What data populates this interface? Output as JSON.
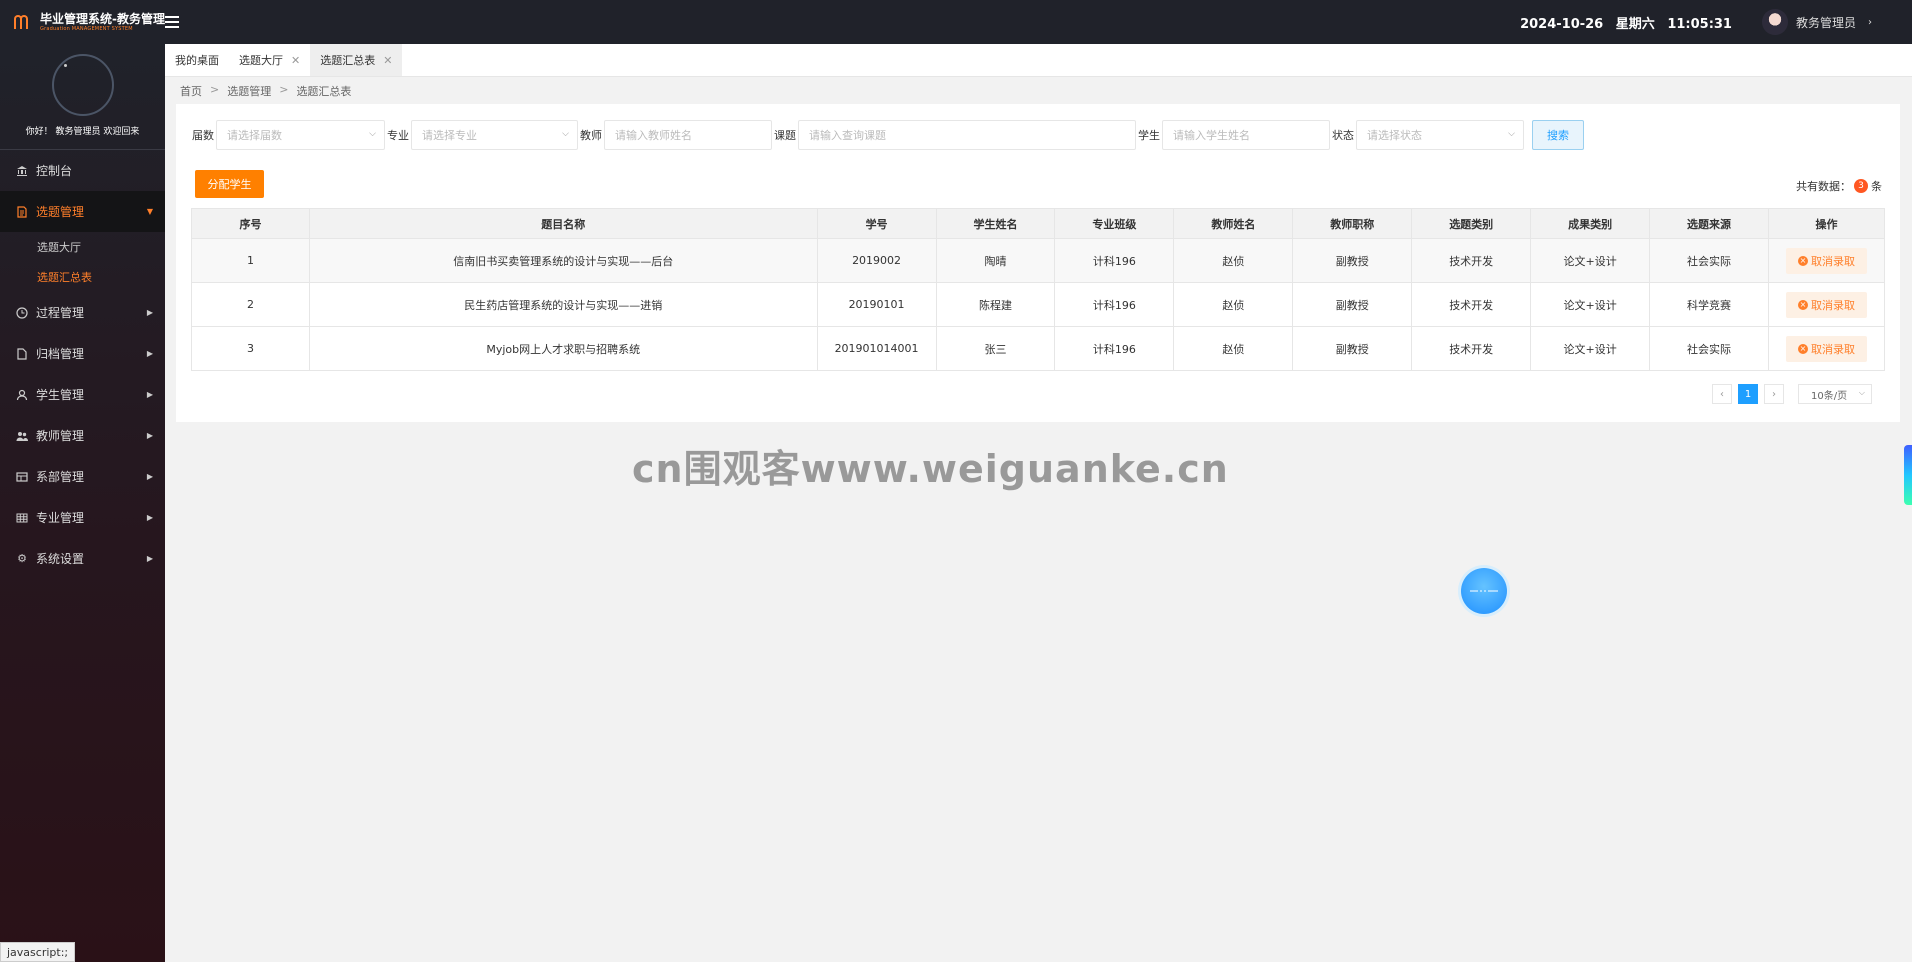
{
  "app": {
    "title": "毕业管理系统-教务管理",
    "subtitle": "Graduation MANAGEMENT SYSTEM",
    "datetime": "2024-10-26",
    "weekday": "星期六",
    "time": "11:05:31",
    "user": "教务管理员"
  },
  "sidebar": {
    "greeting": "你好！ 教务管理员 欢迎回来",
    "items": [
      {
        "label": "控制台",
        "icon": "bank-icon"
      },
      {
        "label": "选题管理",
        "icon": "document-icon",
        "active": true,
        "children": [
          {
            "label": "选题大厅"
          },
          {
            "label": "选题汇总表",
            "active": true
          }
        ]
      },
      {
        "label": "过程管理",
        "icon": "clock-icon"
      },
      {
        "label": "归档管理",
        "icon": "file-icon"
      },
      {
        "label": "学生管理",
        "icon": "user-icon"
      },
      {
        "label": "教师管理",
        "icon": "users-icon"
      },
      {
        "label": "系部管理",
        "icon": "layout-icon"
      },
      {
        "label": "专业管理",
        "icon": "grid-icon"
      },
      {
        "label": "系统设置",
        "icon": "gear-icon"
      }
    ]
  },
  "tabs": [
    {
      "label": "我的桌面"
    },
    {
      "label": "选题大厅",
      "close": "✕"
    },
    {
      "label": "选题汇总表",
      "close": "✕",
      "active": true
    }
  ],
  "breadcrumb": [
    "首页",
    ">",
    "选题管理",
    ">",
    "选题汇总表"
  ],
  "filters": {
    "session_label": "届数",
    "session_placeholder": "请选择届数",
    "major_label": "专业",
    "major_placeholder": "请选择专业",
    "teacher_label": "教师",
    "teacher_placeholder": "请输入教师姓名",
    "topic_label": "课题",
    "topic_placeholder": "请输入查询课题",
    "student_label": "学生",
    "student_placeholder": "请输入学生姓名",
    "status_label": "状态",
    "status_placeholder": "请选择状态",
    "search_button": "搜索"
  },
  "actions": {
    "assign_button": "分配学生",
    "total_prefix": "共有数据：",
    "total_count": "3",
    "total_suffix": "条"
  },
  "table": {
    "headers": [
      "序号",
      "题目名称",
      "学号",
      "学生姓名",
      "专业班级",
      "教师姓名",
      "教师职称",
      "选题类别",
      "成果类别",
      "选题来源",
      "操作"
    ],
    "rows": [
      [
        "1",
        "信南旧书买卖管理系统的设计与实现——后台",
        "2019002",
        "陶晴",
        "计科196",
        "赵侦",
        "副教授",
        "技术开发",
        "论文+设计",
        "社会实际",
        "取消录取"
      ],
      [
        "2",
        "民生药店管理系统的设计与实现——进销",
        "20190101",
        "陈程建",
        "计科196",
        "赵侦",
        "副教授",
        "技术开发",
        "论文+设计",
        "科学竞赛",
        "取消录取"
      ],
      [
        "3",
        "Myjob网上人才求职与招聘系统",
        "201901014001",
        "张三",
        "计科196",
        "赵侦",
        "副教授",
        "技术开发",
        "论文+设计",
        "社会实际",
        "取消录取"
      ]
    ]
  },
  "pagination": {
    "prev": "‹",
    "current": "1",
    "next": "›",
    "page_size": "10条/页"
  },
  "watermark": "cn围观客www.weiguanke.cn",
  "status_bar": "javascript:;",
  "colors": {
    "accent": "#ff7f2a",
    "primary": "#1e9fff",
    "sidebar_bg": "#20222a"
  }
}
